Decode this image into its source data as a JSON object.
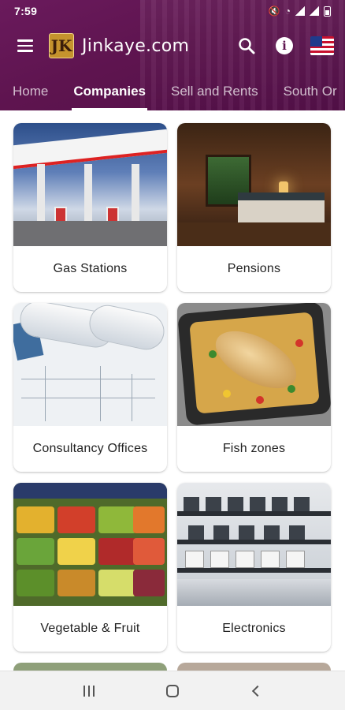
{
  "status_bar": {
    "time": "7:59"
  },
  "app_bar": {
    "brand": "Jinkaye.com",
    "logo_letter": "JK",
    "icons": [
      "menu-icon",
      "search-icon",
      "info-icon",
      "us-flag-icon"
    ],
    "info_glyph": "i"
  },
  "tabs": [
    {
      "label": "Home",
      "active": false
    },
    {
      "label": "Companies",
      "active": true
    },
    {
      "label": "Sell and Rents",
      "active": false
    },
    {
      "label": "South Or",
      "active": false
    }
  ],
  "categories": [
    {
      "label": "Gas Stations"
    },
    {
      "label": "Pensions"
    },
    {
      "label": "Consultancy Offices"
    },
    {
      "label": "Fish zones"
    },
    {
      "label": "Vegetable & Fruit"
    },
    {
      "label": "Electronics"
    }
  ],
  "colors": {
    "header": "#5e144f",
    "accent": "#ffffff",
    "nav_bar": "#f2f2f2"
  }
}
